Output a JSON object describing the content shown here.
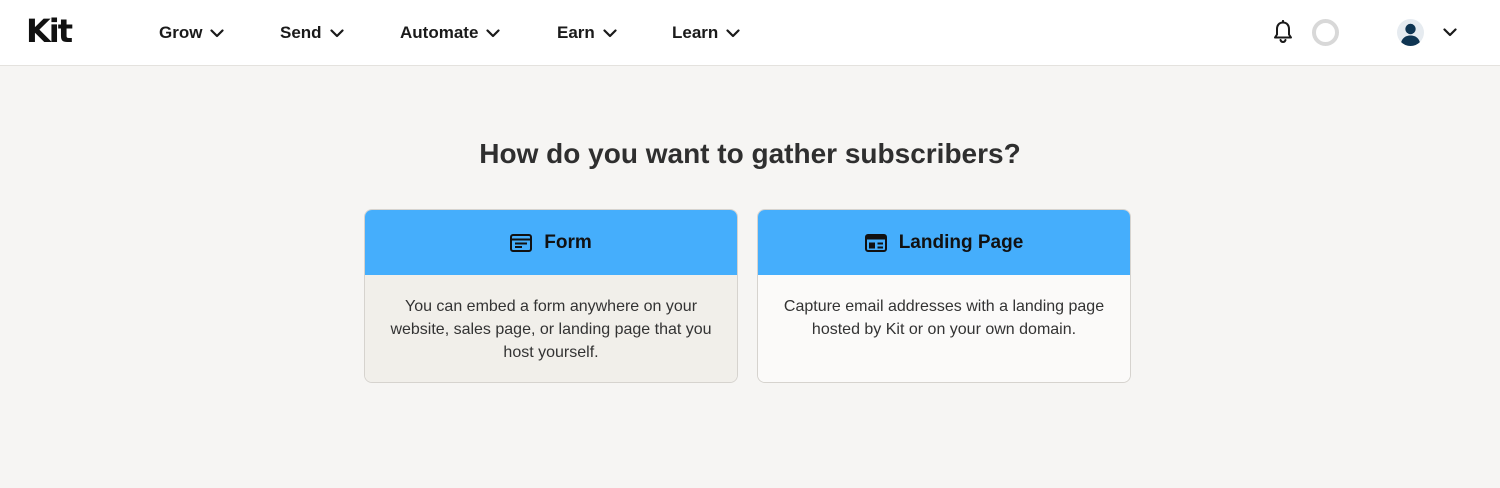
{
  "header": {
    "logo": "Kit",
    "nav": [
      {
        "label": "Grow"
      },
      {
        "label": "Send"
      },
      {
        "label": "Automate"
      },
      {
        "label": "Earn"
      },
      {
        "label": "Learn"
      }
    ]
  },
  "main": {
    "title": "How do you want to gather subscribers?",
    "options": [
      {
        "title": "Form",
        "icon": "form-icon",
        "description": "You can embed a form anywhere on your website, sales page, or landing page that you host yourself."
      },
      {
        "title": "Landing Page",
        "icon": "landing-page-icon",
        "description": "Capture email addresses with a landing page hosted by Kit or on your own domain."
      }
    ]
  },
  "colors": {
    "accent": "#45aefc",
    "background": "#f6f5f3",
    "header_bg": "#ffffff"
  }
}
